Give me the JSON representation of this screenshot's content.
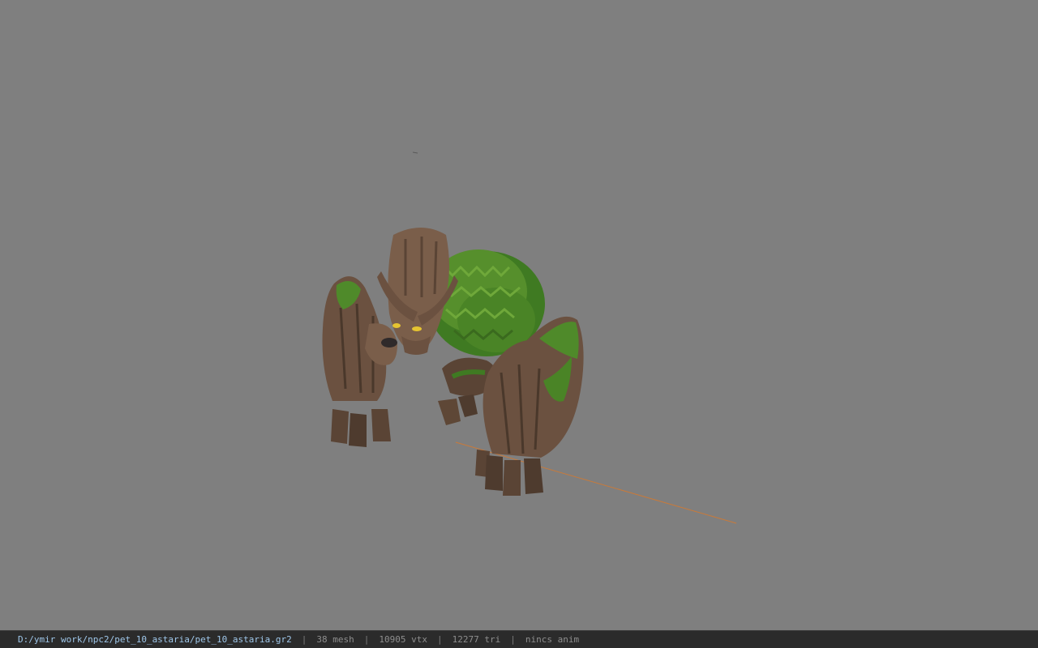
{
  "viewer": {
    "background_color": "#7f7f7f",
    "model": "tree golem creature (pet_10_astaria)"
  },
  "status_bar": {
    "file_path": "D:/ymir work/npc2/pet_10_astaria/pet_10_astaria.gr2",
    "separator": "|",
    "mesh": "38 mesh",
    "vtx": "10905 vtx",
    "tri": "12277 tri",
    "anim": "nincs anim",
    "path_color": "#9fc7ea",
    "text_color": "#8e8e8e",
    "bar_color": "#2b2b2b"
  },
  "colors": {
    "bark": "#6e5442",
    "bark_dark": "#4a382b",
    "leaf": "#4f8a2a",
    "leaf_dark": "#3a6a1e",
    "eye": "#e6c431",
    "axis_line": "#c97a3a"
  }
}
